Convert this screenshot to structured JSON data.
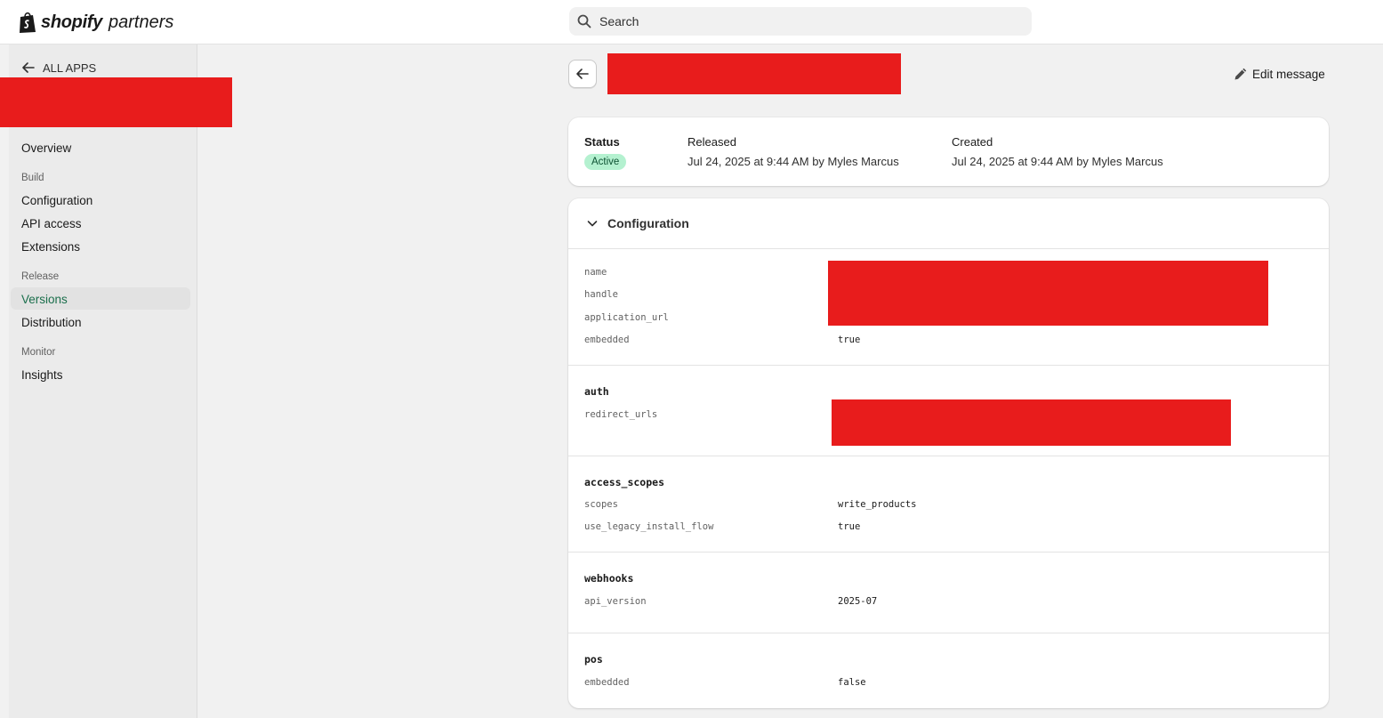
{
  "topbar": {
    "logo_word": "shopify",
    "logo_sub": "partners",
    "search_placeholder": "Search",
    "icons": [
      "shopify-bag-icon",
      "search-icon"
    ]
  },
  "sidebar": {
    "back_label": "ALL APPS",
    "items": [
      {
        "label": "Overview"
      },
      {
        "section": "Build"
      },
      {
        "label": "Configuration"
      },
      {
        "label": "API access"
      },
      {
        "label": "Extensions"
      },
      {
        "section": "Release"
      },
      {
        "label": "Versions",
        "active": true
      },
      {
        "label": "Distribution"
      },
      {
        "section": "Monitor"
      },
      {
        "label": "Insights"
      }
    ]
  },
  "header": {
    "edit_label": "Edit message"
  },
  "status": {
    "status_label": "Status",
    "status_value": "Active",
    "released_label": "Released",
    "released_value": "Jul 24, 2025 at 9:44 AM by Myles Marcus",
    "created_label": "Created",
    "created_value": "Jul 24, 2025 at 9:44 AM by Myles Marcus"
  },
  "configuration": {
    "title": "Configuration",
    "root": {
      "keys": [
        "name",
        "handle",
        "application_url",
        "embedded"
      ],
      "embedded_value": "true"
    },
    "auth": {
      "title": "auth",
      "keys": [
        "redirect_urls"
      ]
    },
    "access_scopes": {
      "title": "access_scopes",
      "rows": [
        {
          "key": "scopes",
          "value": "write_products"
        },
        {
          "key": "use_legacy_install_flow",
          "value": "true"
        }
      ]
    },
    "webhooks": {
      "title": "webhooks",
      "rows": [
        {
          "key": "api_version",
          "value": "2025-07"
        }
      ]
    },
    "pos": {
      "title": "pos",
      "rows": [
        {
          "key": "embedded",
          "value": "false"
        }
      ]
    }
  },
  "colors": {
    "accent_active": "#1b6f4c",
    "badge_bg": "#b4f1d0",
    "redaction": "#e81c1c"
  }
}
